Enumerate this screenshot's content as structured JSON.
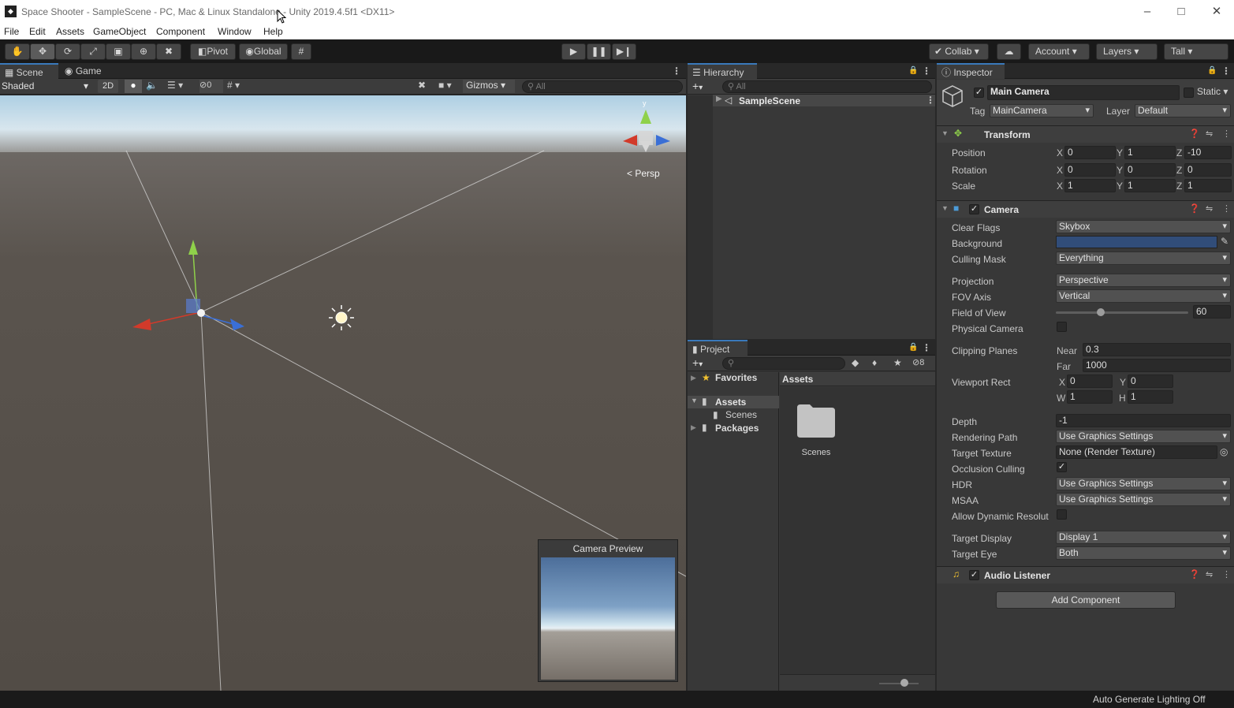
{
  "window": {
    "title": "Space Shooter - SampleScene - PC, Mac & Linux Standalone - Unity 2019.4.5f1 <DX11>",
    "app_icon": "unity-icon",
    "controls": [
      "minimize-icon",
      "maximize-icon",
      "close-icon"
    ]
  },
  "menu": [
    "File",
    "Edit",
    "Assets",
    "GameObject",
    "Component",
    "Window",
    "Help"
  ],
  "toolbar": {
    "tools": [
      "hand-tool-icon",
      "move-tool-icon",
      "rotate-tool-icon",
      "scale-tool-icon",
      "rect-tool-icon",
      "transform-tool-icon",
      "custom-tool-icon"
    ],
    "pivot": "Pivot",
    "global": "Global",
    "collab": "Collab",
    "account": "Account",
    "layers": "Layers",
    "layout": "Tall"
  },
  "scene": {
    "tabs": [
      "Scene",
      "Game"
    ],
    "shading": "Shaded",
    "mode2d": "2D",
    "hidden_count": "0",
    "gizmos": "Gizmos",
    "search_placeholder": "All",
    "persp": "Persp",
    "gizmo_y": "y",
    "camera_preview": "Camera Preview",
    "sky_color": "#c9dfee",
    "ground_color": "#534e48"
  },
  "hierarchy": {
    "tab": "Hierarchy",
    "search_placeholder": "All",
    "scene_name": "SampleScene"
  },
  "project": {
    "tab": "Project",
    "hidden_count": "8",
    "favorites": "Favorites",
    "assets": "Assets",
    "scenes": "Scenes",
    "packages": "Packages",
    "assets_header": "Assets",
    "folder_label": "Scenes"
  },
  "inspector": {
    "tab": "Inspector",
    "object_name": "Main Camera",
    "static_label": "Static",
    "tag_label": "Tag",
    "tag_value": "MainCamera",
    "layer_label": "Layer",
    "layer_value": "Default",
    "transform": {
      "title": "Transform",
      "position_label": "Position",
      "rotation_label": "Rotation",
      "scale_label": "Scale",
      "axes": [
        "X",
        "Y",
        "Z"
      ],
      "position": [
        "0",
        "1",
        "-10"
      ],
      "rotation": [
        "0",
        "0",
        "0"
      ],
      "scale": [
        "1",
        "1",
        "1"
      ]
    },
    "camera": {
      "title": "Camera",
      "clear_flags_label": "Clear Flags",
      "clear_flags": "Skybox",
      "background_label": "Background",
      "background_color": "#314d79",
      "culling_mask_label": "Culling Mask",
      "culling_mask": "Everything",
      "projection_label": "Projection",
      "projection": "Perspective",
      "fov_axis_label": "FOV Axis",
      "fov_axis": "Vertical",
      "fov_label": "Field of View",
      "fov": "60",
      "fov_fraction": 0.34,
      "physical_camera_label": "Physical Camera",
      "clipping_label": "Clipping Planes",
      "near_label": "Near",
      "near": "0.3",
      "far_label": "Far",
      "far": "1000",
      "viewport_label": "Viewport Rect",
      "vp_x_label": "X",
      "vp_x": "0",
      "vp_y_label": "Y",
      "vp_y": "0",
      "vp_w_label": "W",
      "vp_w": "1",
      "vp_h_label": "H",
      "vp_h": "1",
      "depth_label": "Depth",
      "depth": "-1",
      "rendering_path_label": "Rendering Path",
      "rendering_path": "Use Graphics Settings",
      "target_texture_label": "Target Texture",
      "target_texture": "None (Render Texture)",
      "occlusion_label": "Occlusion Culling",
      "hdr_label": "HDR",
      "hdr": "Use Graphics Settings",
      "msaa_label": "MSAA",
      "msaa": "Use Graphics Settings",
      "dynamic_res_label": "Allow Dynamic Resolut",
      "target_display_label": "Target Display",
      "target_display": "Display 1",
      "target_eye_label": "Target Eye",
      "target_eye": "Both"
    },
    "audio_listener": {
      "title": "Audio Listener"
    },
    "add_component": "Add Component"
  },
  "status": {
    "message": "Auto Generate Lighting Off"
  }
}
